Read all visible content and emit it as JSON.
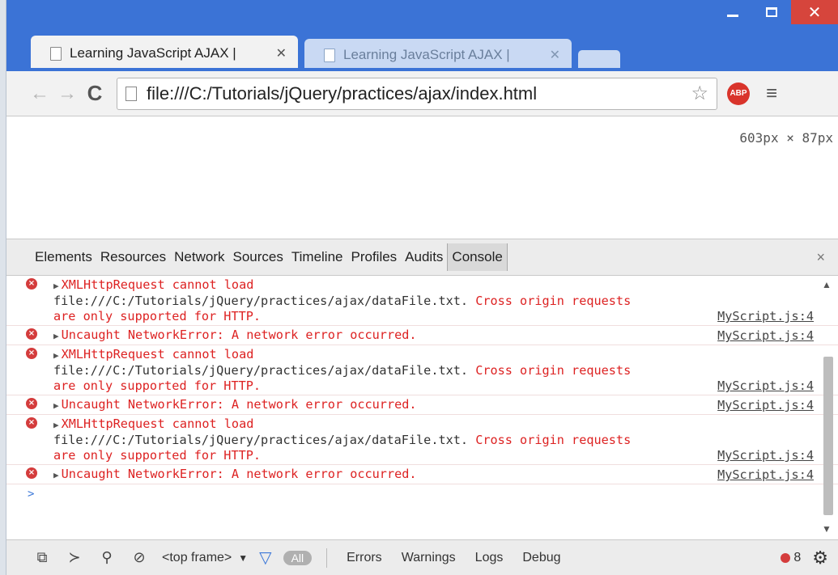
{
  "window": {
    "minimize_label": "–",
    "maximize_label": "□",
    "close_label": "✕"
  },
  "tabs": [
    {
      "label": "Learning JavaScript AJAX |",
      "close": "✕",
      "active": true
    },
    {
      "label": "Learning JavaScript AJAX |",
      "close": "✕",
      "active": false
    }
  ],
  "toolbar": {
    "back": "←",
    "forward": "→",
    "reload": "C",
    "url": "file:///C:/Tutorials/jQuery/practices/ajax/index.html",
    "star": "☆",
    "abp_label": "ABP",
    "menu": "≡"
  },
  "viewport": {
    "size_readout": "603px × 87px"
  },
  "devtools": {
    "tabs": [
      "Elements",
      "Resources",
      "Network",
      "Sources",
      "Timeline",
      "Profiles",
      "Audits",
      "Console"
    ],
    "selected_tab": "Console",
    "close": "×",
    "messages": [
      {
        "line1": "XMLHttpRequest cannot load",
        "line2_plain": "file:///C:/Tutorials/jQuery/practices/ajax/dataFile.txt.",
        "line2_err": " Cross origin requests",
        "line3": "are only supported for HTTP.",
        "source": "MyScript.js:4"
      },
      {
        "line1": "Uncaught NetworkError: A network error occurred.",
        "source": "MyScript.js:4"
      },
      {
        "line1": "XMLHttpRequest cannot load",
        "line2_plain": "file:///C:/Tutorials/jQuery/practices/ajax/dataFile.txt.",
        "line2_err": " Cross origin requests",
        "line3": "are only supported for HTTP.",
        "source": "MyScript.js:4"
      },
      {
        "line1": "Uncaught NetworkError: A network error occurred.",
        "source": "MyScript.js:4"
      },
      {
        "line1": "XMLHttpRequest cannot load",
        "line2_plain": "file:///C:/Tutorials/jQuery/practices/ajax/dataFile.txt.",
        "line2_err": " Cross origin requests",
        "line3": "are only supported for HTTP.",
        "source": "MyScript.js:4"
      },
      {
        "line1": "Uncaught NetworkError: A network error occurred.",
        "source": "MyScript.js:4"
      }
    ],
    "prompt": ">",
    "statusbar": {
      "frame_label": "<top frame>",
      "frame_arrow": "▼",
      "all_label": "All",
      "levels": [
        "Errors",
        "Warnings",
        "Logs",
        "Debug"
      ],
      "error_count": "8"
    }
  },
  "colors": {
    "titlebar": "#3b73d6",
    "close_button": "#d6453c",
    "error_text": "#dd2222",
    "error_icon": "#d43c3c",
    "prompt": "#3c78d8"
  },
  "icons": [
    "page-icon",
    "back-arrow-icon",
    "forward-arrow-icon",
    "reload-icon",
    "star-icon",
    "adblock-icon",
    "menu-icon",
    "error-icon",
    "expand-triangle-icon",
    "dock-icon",
    "drawer-icon",
    "search-icon",
    "clear-icon",
    "filter-icon",
    "gear-icon"
  ]
}
